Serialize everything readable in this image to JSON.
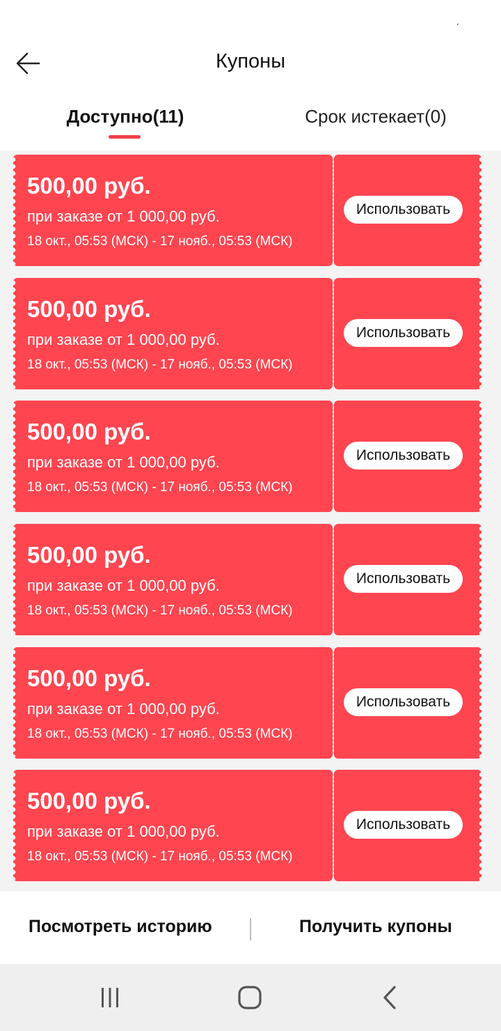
{
  "status_bar": {
    "mark": "ˏ"
  },
  "header": {
    "title": "Купоны"
  },
  "tabs": [
    {
      "label": "Доступно(11)",
      "active": true
    },
    {
      "label": "Срок истекает(0)",
      "active": false
    }
  ],
  "coupons": [
    {
      "amount": "500,00 руб.",
      "condition": "при заказе от 1 000,00 руб.",
      "validity": "18 окт., 05:53 (МСК) - 17 нояб., 05:53 (МСК)",
      "button": "Использовать"
    },
    {
      "amount": "500,00 руб.",
      "condition": "при заказе от 1 000,00 руб.",
      "validity": "18 окт., 05:53 (МСК) - 17 нояб., 05:53 (МСК)",
      "button": "Использовать"
    },
    {
      "amount": "500,00 руб.",
      "condition": "при заказе от 1 000,00 руб.",
      "validity": "18 окт., 05:53 (МСК) - 17 нояб., 05:53 (МСК)",
      "button": "Использовать"
    },
    {
      "amount": "500,00 руб.",
      "condition": "при заказе от 1 000,00 руб.",
      "validity": "18 окт., 05:53 (МСК) - 17 нояб., 05:53 (МСК)",
      "button": "Использовать"
    },
    {
      "amount": "500,00 руб.",
      "condition": "при заказе от 1 000,00 руб.",
      "validity": "18 окт., 05:53 (МСК) - 17 нояб., 05:53 (МСК)",
      "button": "Использовать"
    },
    {
      "amount": "500,00 руб.",
      "condition": "при заказе от 1 000,00 руб.",
      "validity": "18 окт., 05:53 (МСК) - 17 нояб., 05:53 (МСК)",
      "button": "Использовать"
    }
  ],
  "footer": {
    "history_label": "Посмотреть историю",
    "get_coupons_label": "Получить купоны"
  },
  "nav_bar": {
    "icons": [
      "recent-apps-icon",
      "home-icon",
      "back-nav-icon"
    ]
  },
  "colors": {
    "accent": "#ff4550",
    "tab_indicator": "#f0404a",
    "list_background": "#f3f3f3",
    "nav_background": "#efefef"
  }
}
